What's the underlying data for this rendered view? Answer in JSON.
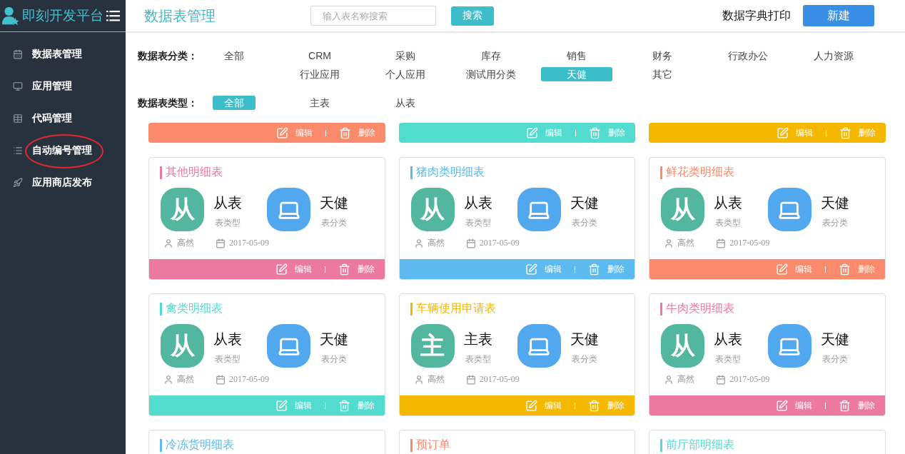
{
  "app": {
    "title": "即刻开发平台"
  },
  "sidebar": {
    "items": [
      {
        "label": "数据表管理",
        "circled": false
      },
      {
        "label": "应用管理",
        "circled": false
      },
      {
        "label": "代码管理",
        "circled": false
      },
      {
        "label": "自动编号管理",
        "circled": true
      },
      {
        "label": "应用商店发布",
        "circled": false
      }
    ]
  },
  "header": {
    "title": "数据表管理",
    "search": {
      "placeholder": "输入表名称搜索"
    },
    "search_button": "搜索",
    "print_link": "数据字典打印",
    "new_button": "新建"
  },
  "filters": {
    "category": {
      "label": "数据表分类：",
      "all": {
        "label": "全部",
        "selected": false
      },
      "options": [
        {
          "label": "CRM",
          "selected": false
        },
        {
          "label": "采购",
          "selected": false
        },
        {
          "label": "库存",
          "selected": false
        },
        {
          "label": "销售",
          "selected": false
        },
        {
          "label": "财务",
          "selected": false
        },
        {
          "label": "行政办公",
          "selected": false
        },
        {
          "label": "人力资源",
          "selected": false
        },
        {
          "label": "行业应用",
          "selected": false
        },
        {
          "label": "个人应用",
          "selected": false
        },
        {
          "label": "测试用分类",
          "selected": false
        },
        {
          "label": "天健",
          "selected": true
        },
        {
          "label": "其它",
          "selected": false
        }
      ]
    },
    "type": {
      "label": "数据表类型：",
      "options": [
        {
          "label": "全部",
          "selected": true
        },
        {
          "label": "主表",
          "selected": false
        },
        {
          "label": "从表",
          "selected": false
        }
      ]
    }
  },
  "cards": [
    {
      "kind": "footer_only",
      "color": "#f98a6b",
      "edit": "编辑",
      "delete": "删除"
    },
    {
      "kind": "footer_only",
      "color": "#52dcd0",
      "edit": "编辑",
      "delete": "删除"
    },
    {
      "kind": "footer_only",
      "color": "#f5b800",
      "edit": "编辑",
      "delete": "删除"
    },
    {
      "kind": "full",
      "color": "#ec79a0",
      "title": "其他明细表",
      "badge": "从",
      "type_label": "从表",
      "type_caption": "表类型",
      "category": "天健",
      "category_caption": "表分类",
      "author": "高然",
      "date": "2017-05-09",
      "edit": "编辑",
      "delete": "删除"
    },
    {
      "kind": "full",
      "color": "#5cbaee",
      "title": "猪肉类明细表",
      "badge": "从",
      "type_label": "从表",
      "type_caption": "表类型",
      "category": "天健",
      "category_caption": "表分类",
      "author": "高然",
      "date": "2017-05-09",
      "edit": "编辑",
      "delete": "删除"
    },
    {
      "kind": "full",
      "color": "#f98a6b",
      "title": "鲜花类明细表",
      "badge": "从",
      "type_label": "从表",
      "type_caption": "表类型",
      "category": "天健",
      "category_caption": "表分类",
      "author": "高然",
      "date": "2017-05-09",
      "edit": "编辑",
      "delete": "删除"
    },
    {
      "kind": "full",
      "color": "#52dcd0",
      "title": "禽类明细表",
      "badge": "从",
      "type_label": "从表",
      "type_caption": "表类型",
      "category": "天健",
      "category_caption": "表分类",
      "author": "高然",
      "date": "2017-05-09",
      "edit": "编辑",
      "delete": "删除"
    },
    {
      "kind": "full",
      "color": "#f5b800",
      "title": "车辆使用申请表",
      "badge": "主",
      "type_label": "主表",
      "type_caption": "表类型",
      "category": "天健",
      "category_caption": "表分类",
      "author": "高然",
      "date": "2017-05-09",
      "edit": "编辑",
      "delete": "删除"
    },
    {
      "kind": "full",
      "color": "#ec79a0",
      "title": "牛肉类明细表",
      "badge": "从",
      "type_label": "从表",
      "type_caption": "表类型",
      "category": "天健",
      "category_caption": "表分类",
      "author": "高然",
      "date": "2017-05-09",
      "edit": "编辑",
      "delete": "删除"
    },
    {
      "kind": "title_only",
      "color": "#5cbaee",
      "title": "冷冻货明细表"
    },
    {
      "kind": "title_only",
      "color": "#f98a6b",
      "title": "预订单"
    },
    {
      "kind": "title_only",
      "color": "#52dcd0",
      "title": "前厅部明细表"
    }
  ]
}
